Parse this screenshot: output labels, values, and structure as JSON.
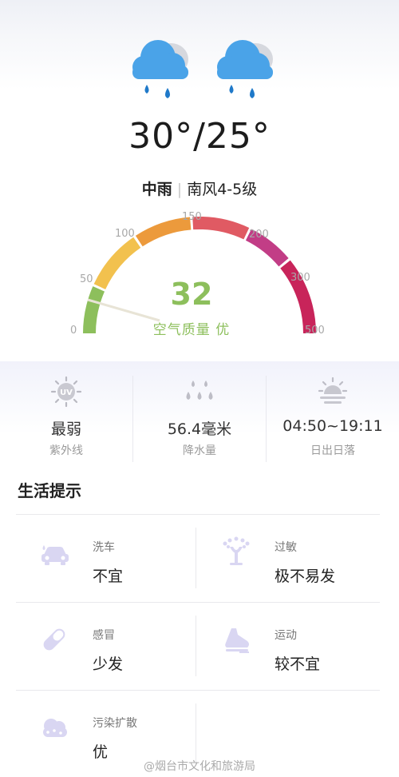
{
  "weather": {
    "temperature": "30°/25°",
    "condition": "中雨",
    "separator": "|",
    "wind": "南风4-5级"
  },
  "aqi": {
    "value": "32",
    "value_numeric": 32,
    "label": "空气质量 优",
    "scale_min": 0,
    "scale_max": 500,
    "ticks": [
      "0",
      "50",
      "100",
      "150",
      "200",
      "300",
      "500"
    ],
    "colors": {
      "good": "#8dbf5c",
      "moderate": "#f2c14e",
      "unhealthy_sensitive": "#ec9a3c",
      "unhealthy": "#e05a63",
      "very_unhealthy": "#c23d86",
      "hazardous": "#c8245a"
    }
  },
  "stats": [
    {
      "icon": "uv-sun-icon",
      "value": "最弱",
      "label": "紫外线"
    },
    {
      "icon": "raindrops-icon",
      "value": "56.4毫米",
      "label": "降水量"
    },
    {
      "icon": "sunrise-sunset-icon",
      "value": "04:50~19:11",
      "label": "日出日落"
    }
  ],
  "life_tips": {
    "title": "生活提示",
    "items": [
      {
        "icon": "car-wash-icon",
        "label": "洗车",
        "value": "不宜"
      },
      {
        "icon": "pollen-allergy-icon",
        "label": "过敏",
        "value": "极不易发"
      },
      {
        "icon": "pill-capsule-icon",
        "label": "感冒",
        "value": "少发"
      },
      {
        "icon": "running-shoe-icon",
        "label": "运动",
        "value": "较不宜"
      },
      {
        "icon": "cloud-dispersion-icon",
        "label": "污染扩散",
        "value": "优"
      }
    ]
  },
  "watermark": "@烟台市文化和旅游局",
  "accent_icon_color": "#d9d6f2"
}
